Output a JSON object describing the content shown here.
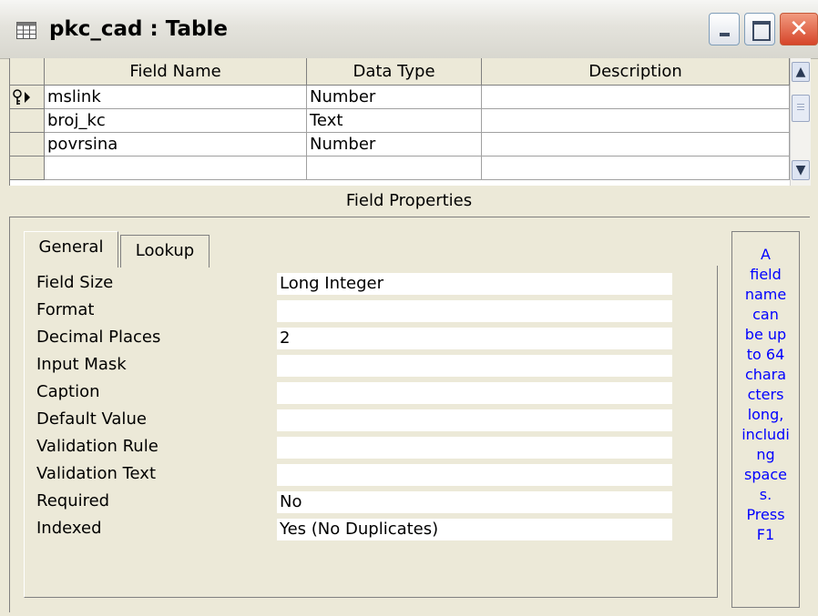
{
  "window": {
    "title": "pkc_cad : Table",
    "icon": "table-icon"
  },
  "grid": {
    "headers": [
      "Field Name",
      "Data Type",
      "Description"
    ],
    "rows": [
      {
        "field_name": "mslink",
        "data_type": "Number",
        "description": "",
        "is_primary_key": true,
        "is_current": true
      },
      {
        "field_name": "broj_kc",
        "data_type": "Text",
        "description": ""
      },
      {
        "field_name": "povrsina",
        "data_type": "Number",
        "description": ""
      },
      {
        "field_name": "",
        "data_type": "",
        "description": ""
      }
    ]
  },
  "field_properties": {
    "header": "Field Properties",
    "tabs": [
      "General",
      "Lookup"
    ],
    "active_tab": "General",
    "properties": [
      {
        "label": "Field Size",
        "value": "Long Integer"
      },
      {
        "label": "Format",
        "value": ""
      },
      {
        "label": "Decimal Places",
        "value": "2"
      },
      {
        "label": "Input Mask",
        "value": ""
      },
      {
        "label": "Caption",
        "value": ""
      },
      {
        "label": "Default Value",
        "value": ""
      },
      {
        "label": "Validation Rule",
        "value": ""
      },
      {
        "label": "Validation Text",
        "value": ""
      },
      {
        "label": "Required",
        "value": "No"
      },
      {
        "label": "Indexed",
        "value": "Yes (No Duplicates)"
      }
    ],
    "help_lines": [
      "A",
      "field",
      "name",
      "can",
      "be up",
      "to 64",
      "chara",
      "cters",
      "long,",
      "includi",
      "ng",
      "space",
      "s.",
      "Press",
      "F1"
    ]
  },
  "colors": {
    "help_text": "#0000ff",
    "panel_bg": "#ece9d8",
    "close_button": "#d6452a"
  }
}
